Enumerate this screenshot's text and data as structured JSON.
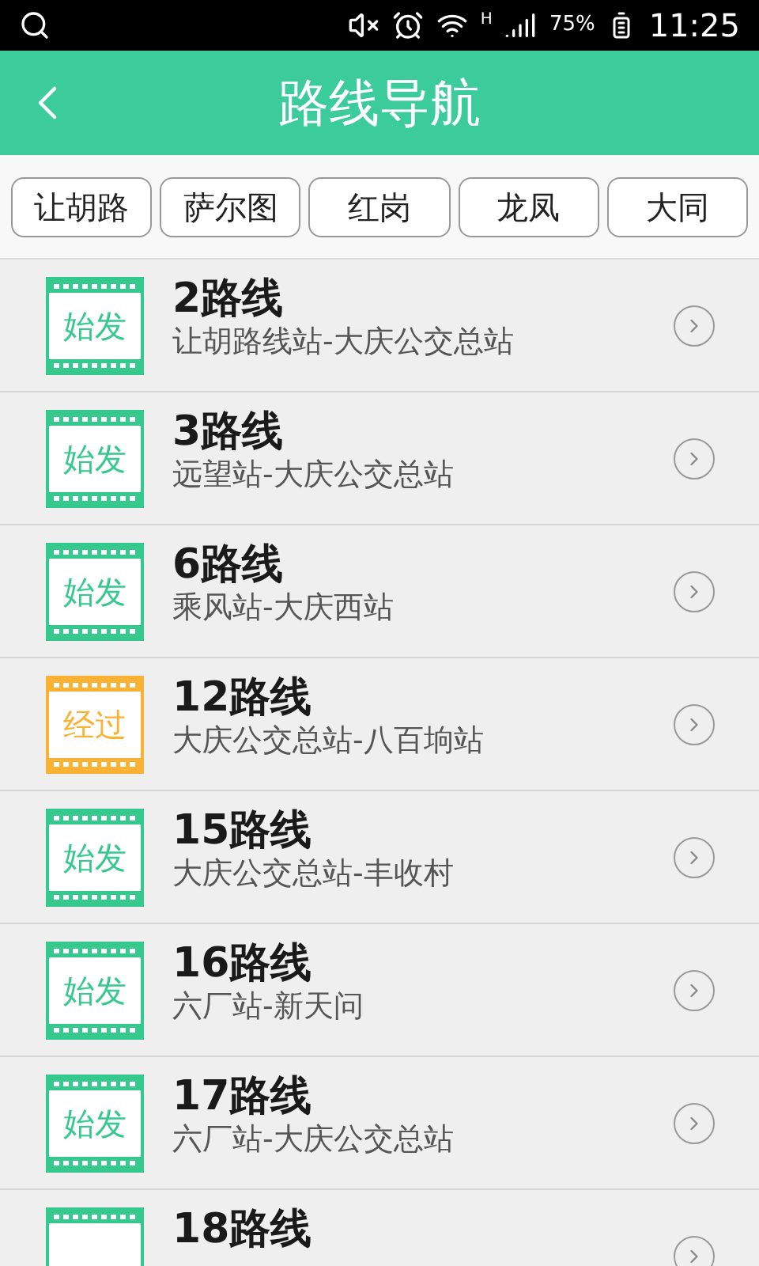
{
  "status_bar": {
    "network": "H",
    "battery": "75%",
    "time": "11:25"
  },
  "header": {
    "title": "路线导航"
  },
  "tabs": [
    {
      "label": "让胡路"
    },
    {
      "label": "萨尔图"
    },
    {
      "label": "红岗"
    },
    {
      "label": "龙凤"
    },
    {
      "label": "大同"
    }
  ],
  "routes": [
    {
      "name": "2路线",
      "stops": "让胡路线站-大庆公交总站",
      "badge": {
        "kind": "start",
        "label": "始发"
      }
    },
    {
      "name": "3路线",
      "stops": "远望站-大庆公交总站",
      "badge": {
        "kind": "start",
        "label": "始发"
      }
    },
    {
      "name": "6路线",
      "stops": "乘风站-大庆西站",
      "badge": {
        "kind": "start",
        "label": "始发"
      }
    },
    {
      "name": "12路线",
      "stops": "大庆公交总站-八百垧站",
      "badge": {
        "kind": "via",
        "label": "经过"
      }
    },
    {
      "name": "15路线",
      "stops": "大庆公交总站-丰收村",
      "badge": {
        "kind": "start",
        "label": "始发"
      }
    },
    {
      "name": "16路线",
      "stops": "六厂站-新天问",
      "badge": {
        "kind": "start",
        "label": "始发"
      }
    },
    {
      "name": "17路线",
      "stops": "六厂站-大庆公交总站",
      "badge": {
        "kind": "start",
        "label": "始发"
      }
    },
    {
      "name": "18路线",
      "badge": {
        "kind": "start"
      }
    }
  ]
}
